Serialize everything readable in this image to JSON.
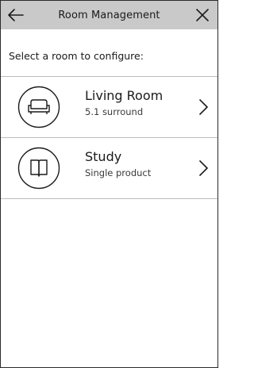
{
  "header": {
    "title": "Room Management",
    "back_icon": "arrow-left-icon",
    "close_icon": "close-icon"
  },
  "prompt": "Select a room to configure:",
  "rooms": [
    {
      "name": "Living Room",
      "description": "5.1 surround",
      "icon": "sofa-icon"
    },
    {
      "name": "Study",
      "description": "Single product",
      "icon": "book-icon"
    }
  ],
  "colors": {
    "header_background": "#c9c9c9",
    "background": "#ffffff",
    "text": "#1a1a1a",
    "divider": "#bdbdbd"
  }
}
